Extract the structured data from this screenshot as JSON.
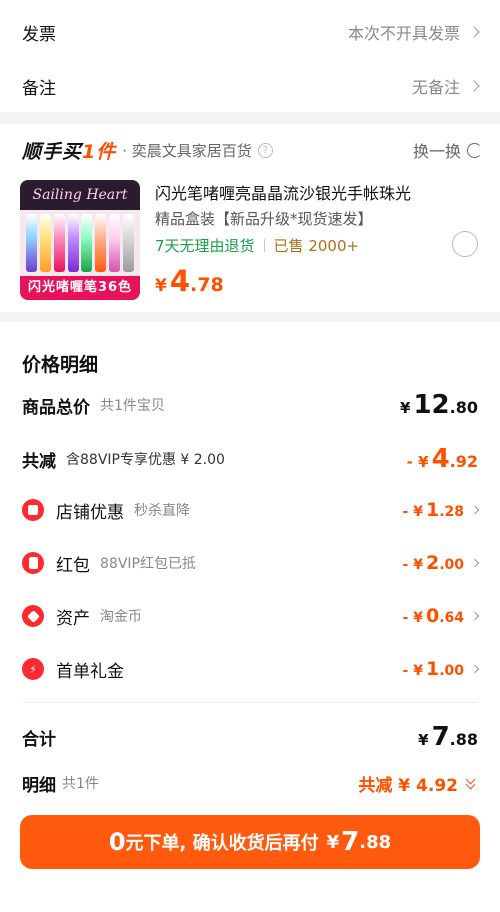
{
  "order_options": {
    "invoice_label": "发票",
    "invoice_value": "本次不开具发票",
    "remark_label": "备注",
    "remark_value": "无备注"
  },
  "recommend": {
    "brand_prefix": "顺手买",
    "brand_suffix": "1件",
    "shop_name": "· 奕晨文具家居百货",
    "help_icon": "question-mark",
    "swap_label": "换一换",
    "swap_icon": "refresh",
    "product": {
      "image_header_text": "Sailing Heart",
      "image_band_text": "闪光啫喱笔36色",
      "title": "闪光笔啫喱亮晶晶流沙银光手帐珠光",
      "subtitle": "精品盒装【新品升级*现货速发】",
      "return_policy": "7天无理由退货",
      "sold": "已售 2000+",
      "price_currency": "¥",
      "price_int": "4",
      "price_dec": ".78",
      "selected": false
    }
  },
  "price_detail": {
    "title": "价格明细",
    "goods_total": {
      "label": "商品总价",
      "note": "共1件宝贝",
      "currency": "¥",
      "int": "12",
      "dec": ".80"
    },
    "total_discount": {
      "label": "共减",
      "note": "含88VIP专享优惠 ¥ 2.00",
      "currency": "- ¥",
      "int": "4",
      "dec": ".92"
    },
    "discounts": [
      {
        "icon": "store-icon",
        "label": "店铺优惠",
        "note": "秒杀直降",
        "currency": "- ¥",
        "int": "1",
        "dec": ".28"
      },
      {
        "icon": "red-packet-icon",
        "label": "红包",
        "note": "88VIP红包已抵",
        "currency": "- ¥",
        "int": "2",
        "dec": ".00"
      },
      {
        "icon": "asset-tag-icon",
        "label": "资产",
        "note": "淘金币",
        "currency": "- ¥",
        "int": "0",
        "dec": ".64"
      },
      {
        "icon": "lightning-icon",
        "label": "首单礼金",
        "note": "",
        "currency": "- ¥",
        "int": "1",
        "dec": ".00"
      }
    ],
    "sum": {
      "label": "合计",
      "currency": "¥",
      "int": "7",
      "dec": ".88"
    },
    "breakdown": {
      "label": "明细",
      "count": "共1件",
      "summary": "共减 ¥ 4.92"
    }
  },
  "cta": {
    "zero": "0",
    "text": "元下单, 确认收货后再付",
    "currency": "¥",
    "int": "7",
    "dec": ".88"
  },
  "colors": {
    "accent": "#ff5000",
    "button": "#ff5a0e",
    "icon_red": "#ff2a30",
    "green": "#1aa34a"
  }
}
